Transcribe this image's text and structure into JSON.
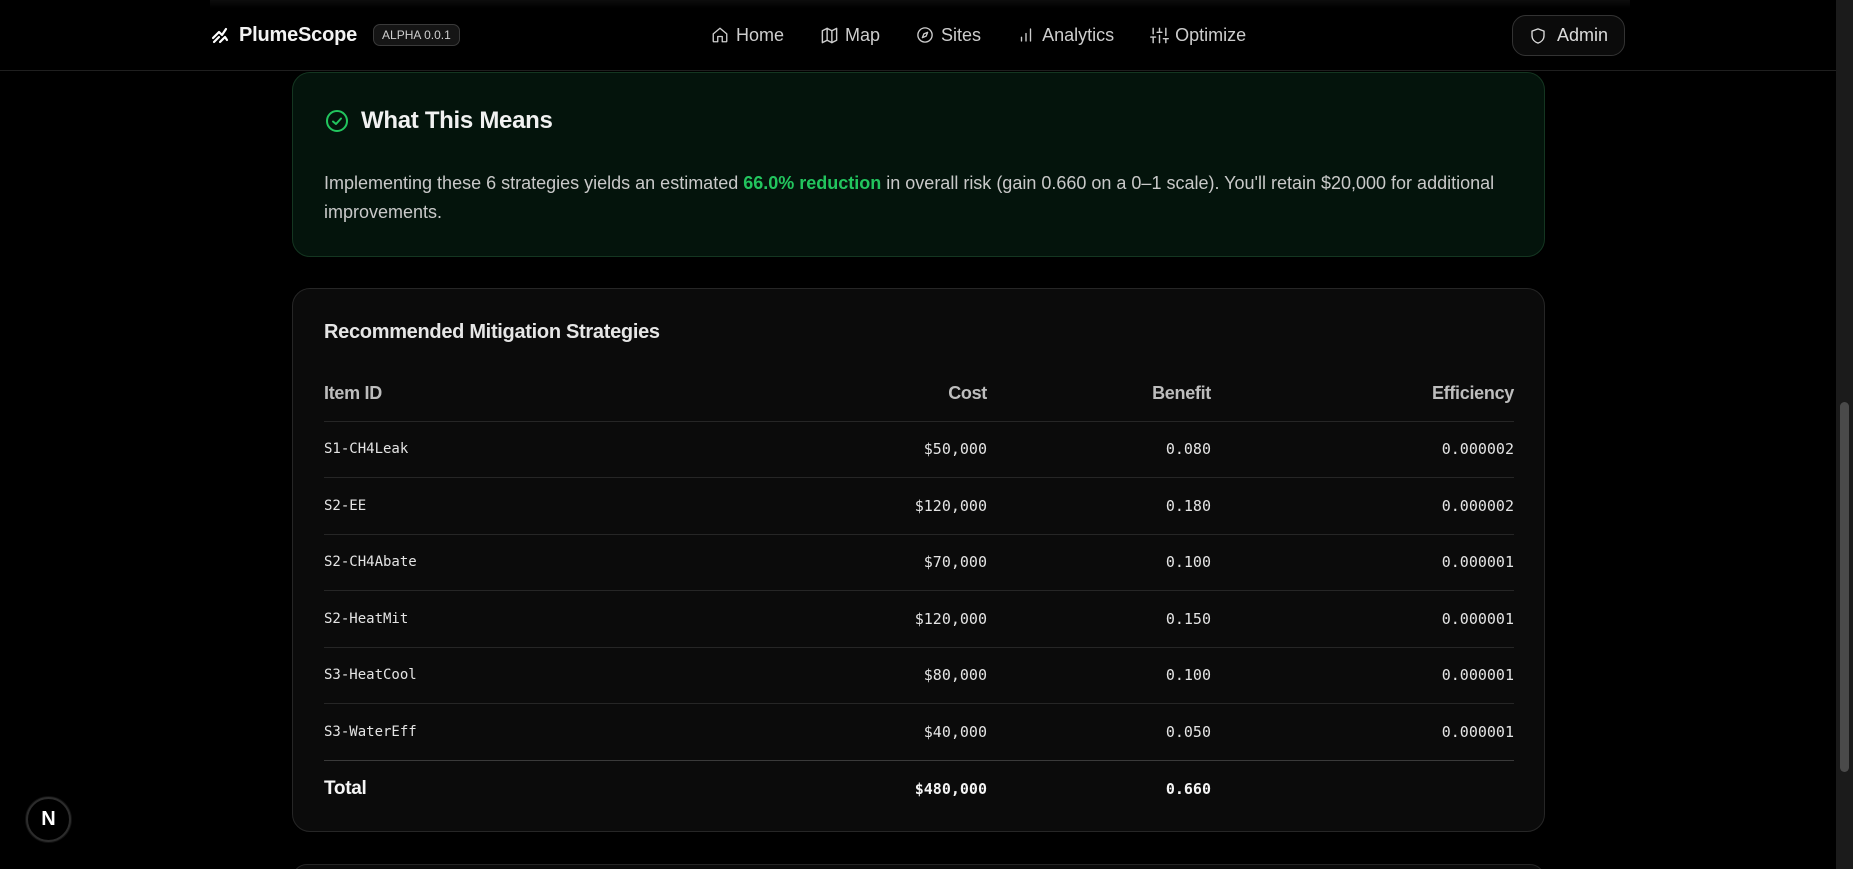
{
  "header": {
    "brand_name": "PlumeScope",
    "version_badge": "ALPHA 0.0.1",
    "nav": [
      {
        "label": "Home",
        "icon": "home-icon"
      },
      {
        "label": "Map",
        "icon": "map-icon"
      },
      {
        "label": "Sites",
        "icon": "compass-icon"
      },
      {
        "label": "Analytics",
        "icon": "bar-chart-icon"
      },
      {
        "label": "Optimize",
        "icon": "sliders-icon"
      }
    ],
    "admin_label": "Admin"
  },
  "summary": {
    "title": "What This Means",
    "text_before": "Implementing these 6 strategies yields an estimated ",
    "highlight": "66.0% reduction",
    "text_after": " in overall risk (gain 0.660 on a 0–1 scale). You'll retain $20,000 for additional improvements."
  },
  "strategies": {
    "title": "Recommended Mitigation Strategies",
    "columns": {
      "item_id": "Item ID",
      "cost": "Cost",
      "benefit": "Benefit",
      "efficiency": "Efficiency"
    },
    "rows": [
      {
        "id": "S1-CH4Leak",
        "cost": "$50,000",
        "benefit": "0.080",
        "efficiency": "0.000002"
      },
      {
        "id": "S2-EE",
        "cost": "$120,000",
        "benefit": "0.180",
        "efficiency": "0.000002"
      },
      {
        "id": "S2-CH4Abate",
        "cost": "$70,000",
        "benefit": "0.100",
        "efficiency": "0.000001"
      },
      {
        "id": "S2-HeatMit",
        "cost": "$120,000",
        "benefit": "0.150",
        "efficiency": "0.000001"
      },
      {
        "id": "S3-HeatCool",
        "cost": "$80,000",
        "benefit": "0.100",
        "efficiency": "0.000001"
      },
      {
        "id": "S3-WaterEff",
        "cost": "$40,000",
        "benefit": "0.050",
        "efficiency": "0.000001"
      }
    ],
    "total": {
      "label": "Total",
      "cost": "$480,000",
      "benefit": "0.660"
    }
  },
  "floating_button": {
    "label": "N"
  },
  "colors": {
    "accent_green": "#22c55e",
    "background": "#000000",
    "card": "#0b0b0b"
  }
}
